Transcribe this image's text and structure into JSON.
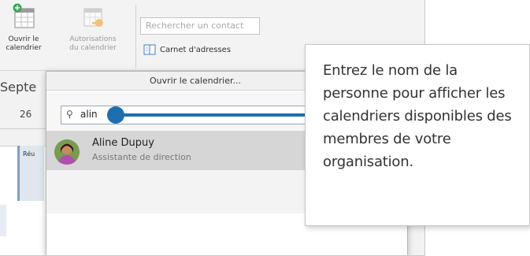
{
  "ribbon": {
    "open_calendar_label_1": "Ouvrir le",
    "open_calendar_label_2": "calendrier",
    "permissions_label_1": "Autorisations",
    "permissions_label_2": "du calendrier",
    "search_placeholder": "Rechercher un contact",
    "address_book_label": "Carnet d'adresses"
  },
  "calendar": {
    "month_partial": "Septe",
    "day": "26",
    "event_label": "Réu"
  },
  "dialog": {
    "title": "Ouvrir le calendrier...",
    "search_value": "alin",
    "result": {
      "name": "Aline Dupuy",
      "title": "Assistante de direction"
    }
  },
  "callout": {
    "text": "Entrez le nom de la personne pour afficher les calendriers disponibles des membres de votre organisation."
  },
  "colors": {
    "accent": "#1e6fb0",
    "selection": "#d6d6d6"
  }
}
